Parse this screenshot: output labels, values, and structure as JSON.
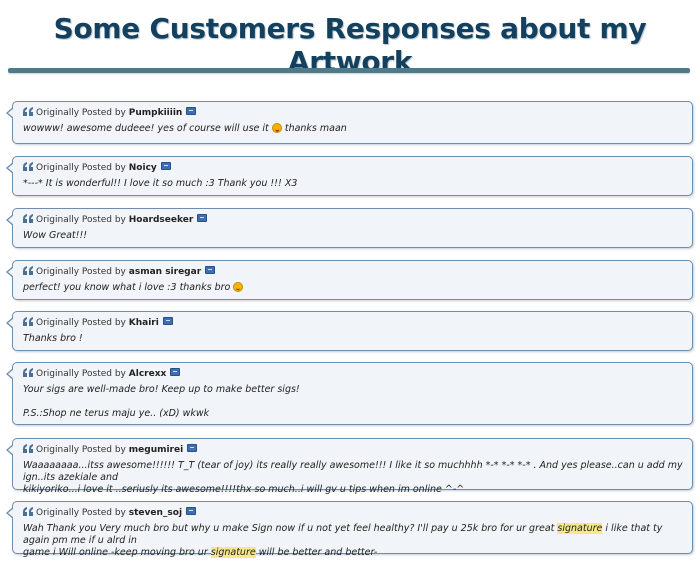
{
  "page": {
    "title": "Some Customers Responses about my Artwork"
  },
  "quotes": [
    {
      "prefix": "Originally Posted by",
      "poster": "Pumpkiiiin",
      "lines": [
        {
          "before": "wowww! awesome dudeee! yes of course will use it",
          "emoticon": "tongue-smiley-icon",
          "after": "thanks maan"
        }
      ]
    },
    {
      "prefix": "Originally Posted by",
      "poster": "Noicy",
      "lines": [
        {
          "text": "*---* It is wonderful!! I love it so much :3 Thank you !!! X3"
        }
      ]
    },
    {
      "prefix": "Originally Posted by",
      "poster": "Hoardseeker",
      "lines": [
        {
          "text": "Wow Great!!!"
        }
      ]
    },
    {
      "prefix": "Originally Posted by",
      "poster": "asman siregar",
      "lines": [
        {
          "before": "perfect! you know what i love :3 thanks bro",
          "emoticon": "smiley-icon",
          "after": ""
        }
      ]
    },
    {
      "prefix": "Originally Posted by",
      "poster": "Khairi",
      "lines": [
        {
          "text": "Thanks bro !"
        }
      ]
    },
    {
      "prefix": "Originally Posted by",
      "poster": "Alcrexx",
      "lines": [
        {
          "text": "Your sigs are well-made bro! Keep up to make better sigs!"
        },
        {
          "text": ""
        },
        {
          "text": "P.S.:Shop ne terus maju ye.. (xD) wkwk"
        }
      ]
    },
    {
      "prefix": "Originally Posted by",
      "poster": "megumirei",
      "lines": [
        {
          "text": "Waaaaaaaa...itss awesome!!!!!! T_T (tear of joy) its really really awesome!!! I like it so muchhhh *-* *-* *-* . And yes please..can u add my ign..its azekiale and"
        },
        {
          "text": "kikiyoriko...i love it ..seriusly its awesome!!!!thx so much..i will gv u tips when im online ^-^"
        }
      ]
    },
    {
      "prefix": "Originally Posted by",
      "poster": "steven_soj",
      "lines": [
        {
          "segments": [
            "Wah Thank you Very much bro but why u make Sign now if u not yet feel healthy? I'll pay u 25k bro for ur great ",
            "signature",
            " i like that ty again pm me if u alrd in"
          ]
        },
        {
          "segments": [
            "game i Will online -keep moving bro ur ",
            "signature",
            " will be better and better-"
          ]
        }
      ]
    }
  ],
  "icons": {
    "quote_icon": "quote-icon",
    "view_post_icon": "view-post-icon"
  },
  "colors": {
    "title": "#12405e",
    "divider": "#4f7a8a",
    "quote_bg": "#f1f4f8",
    "quote_border": "#6e8eae",
    "highlight": "#f5e88a"
  }
}
